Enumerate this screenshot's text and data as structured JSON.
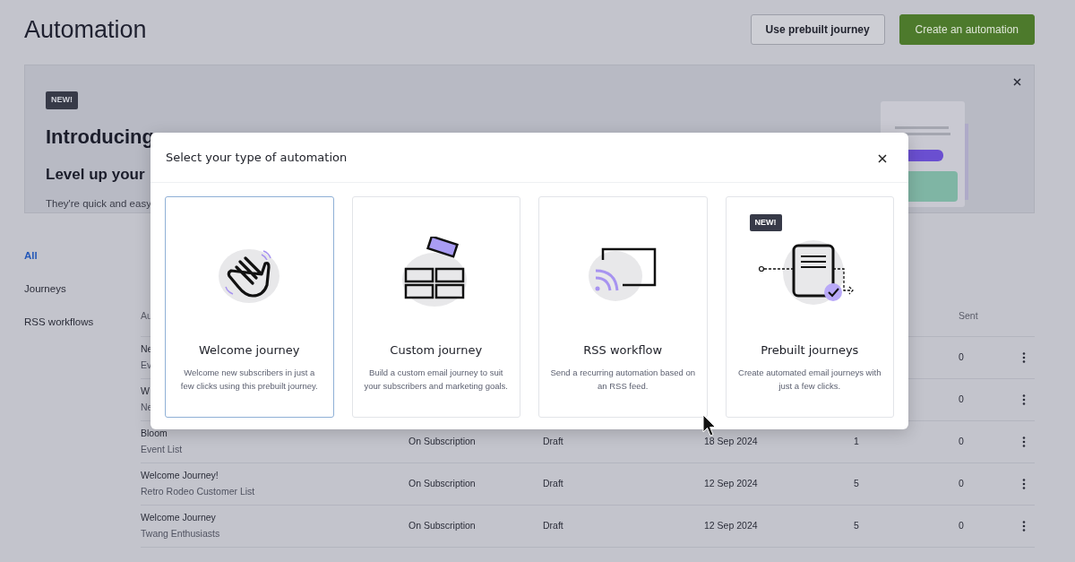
{
  "header": {
    "title": "Automation",
    "buttons": [
      {
        "label": "Use prebuilt journey",
        "kind": "secondary"
      },
      {
        "label": "Create an automation",
        "kind": "primary"
      }
    ]
  },
  "banner": {
    "badge": "NEW!",
    "title": "Introducing",
    "subtitle": "Level up your",
    "text": "They're quick and easy"
  },
  "nav": [
    {
      "label": "All",
      "selected": true
    },
    {
      "label": "Journeys",
      "selected": false
    },
    {
      "label": "RSS workflows",
      "selected": false
    }
  ],
  "table": {
    "columns": {
      "column_1": "Au",
      "column_6": "Sent"
    },
    "rows": [
      {
        "name": "Ne",
        "list": "Ev",
        "sent": "0"
      },
      {
        "name": "W",
        "list": "Ne",
        "sent": "0"
      },
      {
        "name": "Bloom",
        "list": "Event List",
        "trigger": "On Subscription",
        "status": "Draft",
        "date": "18 Sep 2024",
        "column_5": "1",
        "sent": "0"
      },
      {
        "name": "Welcome Journey!",
        "list": "Retro Rodeo Customer List",
        "trigger": "On Subscription",
        "status": "Draft",
        "date": "12 Sep 2024",
        "column_5": "5",
        "sent": "0"
      },
      {
        "name": "Welcome Journey",
        "list": "Twang Enthusiasts",
        "trigger": "On Subscription",
        "status": "Draft",
        "date": "12 Sep 2024",
        "column_5": "5",
        "sent": "0"
      }
    ]
  },
  "modal": {
    "title": "Select your type of automation",
    "cards": [
      {
        "kind": "wave",
        "title": "Welcome journey",
        "description": "Welcome new subscribers in just a few clicks using this prebuilt journey.",
        "selected": true
      },
      {
        "kind": "grid",
        "title": "Custom journey",
        "description": "Build a custom email journey to suit your subscribers and marketing goals.",
        "selected": false
      },
      {
        "kind": "rss",
        "title": "RSS workflow",
        "description": "Send a recurring automation based on an RSS feed.",
        "selected": false
      },
      {
        "kind": "document",
        "title": "Prebuilt journeys",
        "description": "Create automated email journeys with just a few clicks.",
        "selected": false,
        "badge": "NEW!"
      }
    ]
  }
}
